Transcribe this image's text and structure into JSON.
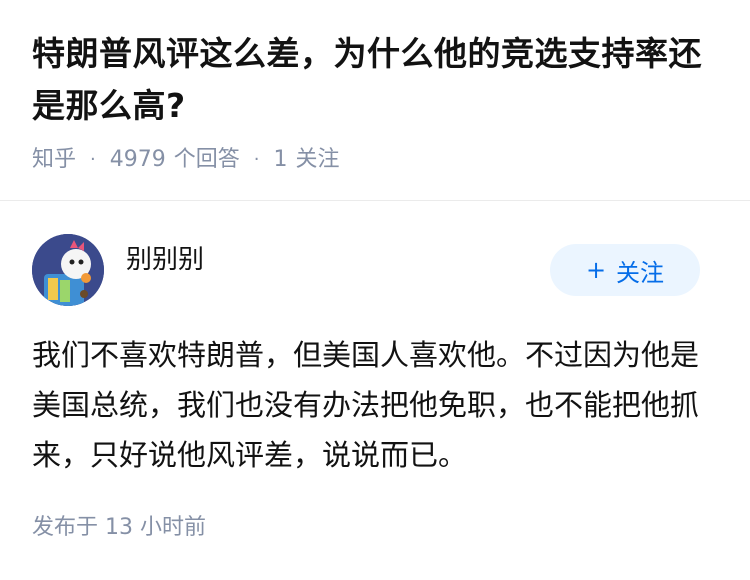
{
  "question": {
    "title": "特朗普风评这么差，为什么他的竞选支持率还是那么高?",
    "source": "知乎",
    "answer_count": "4979",
    "answer_label": "个回答",
    "follower_count": "1",
    "follower_label": "关注"
  },
  "answer": {
    "author_name": "别别别",
    "avatar_icon": "avatar-cartoon-icon",
    "follow_label": "关注",
    "follow_icon": "plus-icon",
    "content": "我们不喜欢特朗普，但美国人喜欢他。不过因为他是美国总统，我们也没有办法把他免职，也不能把他抓来，只好说他风评差，说说而已。",
    "published_time": "发布于 13 小时前"
  },
  "colors": {
    "meta_text": "#8590a6",
    "accent": "#056de8",
    "follow_bg": "#ebf5ff",
    "avatar_bg": "#3b4a8c"
  }
}
